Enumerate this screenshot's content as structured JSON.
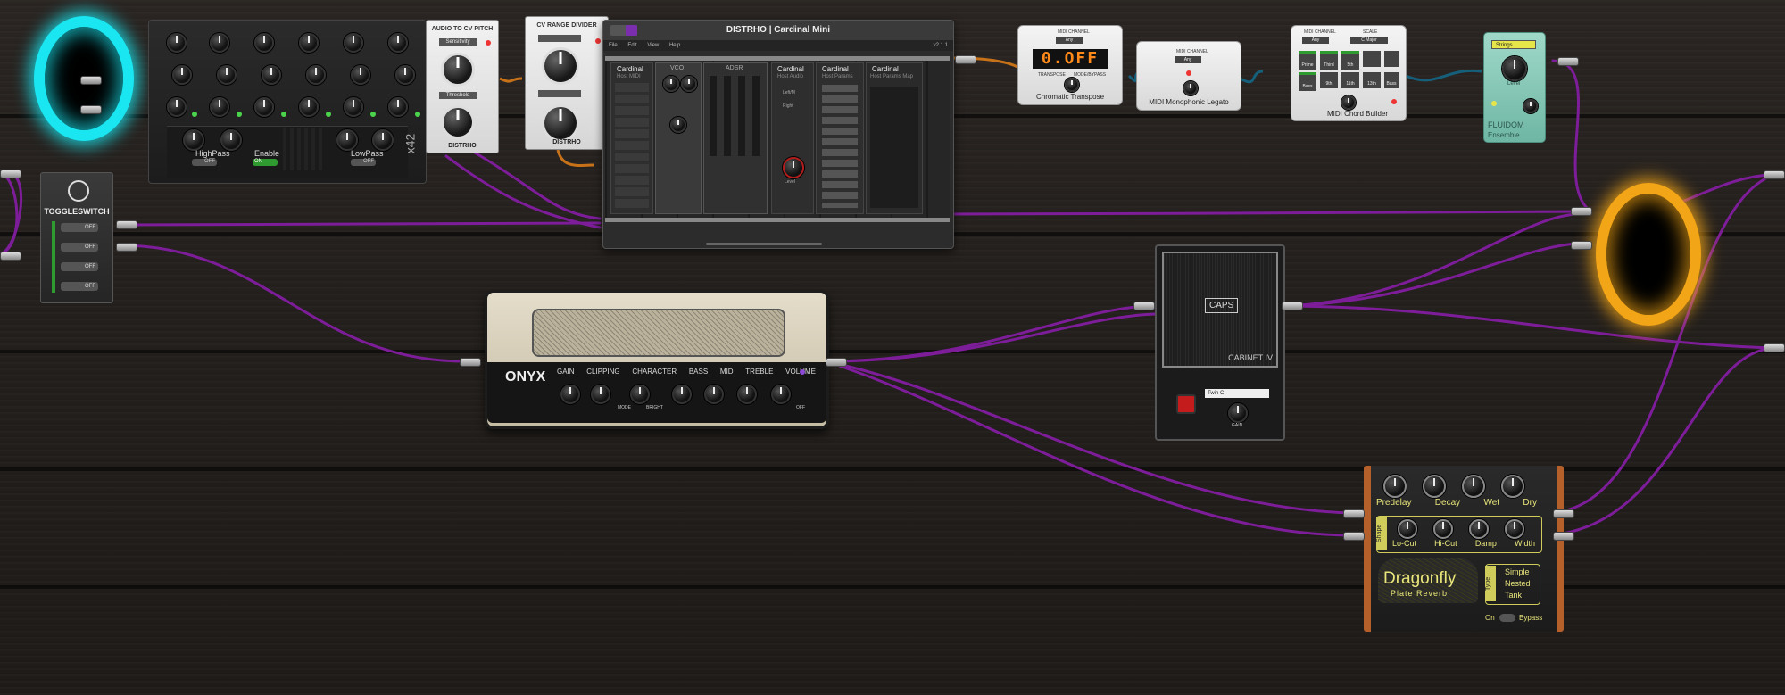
{
  "colors": {
    "cable": "#8a1fa6",
    "portal_left": "#19e6f0",
    "portal_right": "#f2a516",
    "wood": "#231f1c"
  },
  "mixer": {
    "highpass_label": "HighPass",
    "enable_label": "Enable",
    "lowpass_label": "LowPass",
    "x_label": "x42",
    "off": "OFF",
    "on": "ON"
  },
  "toggleswitch": {
    "title": "TOGGLESWITCH",
    "states": [
      "OFF",
      "OFF",
      "OFF",
      "OFF"
    ]
  },
  "audio_cv": {
    "title": "AUDIO TO CV PITCH",
    "sensitivity": "Sensitivity",
    "threshold": "Threshold",
    "brand": "DISTRHO"
  },
  "cv_range": {
    "title": "CV RANGE DIVIDER",
    "brand": "DISTRHO"
  },
  "cardinal": {
    "window_title": "DISTRHO | Cardinal Mini",
    "menu": [
      "File",
      "Edit",
      "View",
      "Help"
    ],
    "version": "v2.1.1",
    "brand": "Cardinal",
    "modules": [
      "Host MIDI",
      "VCO",
      "ADSR",
      "Host Audio",
      "Host Params",
      "Host Params Map"
    ],
    "midi_rows": [
      "V/Oct",
      "Gate",
      "Velocity",
      "Aftertouch",
      "Pitchbend",
      "Mod Wheel",
      "Retrigger",
      "Clock",
      "Start",
      "Stop",
      "Continue"
    ],
    "audio_labels": [
      "Left/M",
      "Right",
      "Level"
    ]
  },
  "chromatic": {
    "title": "Chromatic Transpose",
    "midi_label": "MIDI CHANNEL",
    "midi_value": "Any",
    "display": "0.OFF",
    "transpose": "TRANSPOSE",
    "mode": "MODE/BYPASS"
  },
  "legato": {
    "title": "MIDI Monophonic Legato",
    "midi_label": "MIDI CHANNEL",
    "midi_value": "Any"
  },
  "chord": {
    "title": "MIDI Chord Builder",
    "midi_label": "MIDI CHANNEL",
    "midi_value": "Any",
    "scale_label": "SCALE",
    "scale_value": "C Major",
    "buttons": [
      "Prime",
      "Third",
      "5th",
      "",
      "Bass",
      "9th",
      "11th",
      "13th",
      "Bass"
    ]
  },
  "fluidom": {
    "title": "FLUIDOM",
    "subtitle": "Ensemble",
    "select": "Strings",
    "level": "Level"
  },
  "amp": {
    "brand": "ONYX",
    "controls": [
      "GAIN",
      "CLIPPING",
      "CHARACTER",
      "BASS",
      "MID",
      "TREBLE",
      "VOLUME"
    ],
    "sub_labels": [
      "MODE",
      "BRIGHT",
      "OFF"
    ]
  },
  "cabinet": {
    "brand": "CAPS",
    "model": "CABINET IV",
    "preset": "Twin C",
    "gain": "GAIN"
  },
  "dragonfly": {
    "knobs_top": [
      "Predelay",
      "Decay",
      "Wet",
      "Dry"
    ],
    "knobs_mid": [
      "Lo-Cut",
      "Hi-Cut",
      "Damp",
      "Width"
    ],
    "shape_label": "Shape",
    "type_label": "Type",
    "types": [
      "Simple",
      "Nested",
      "Tank"
    ],
    "name": "Dragonfly",
    "sub": "Plate Reverb",
    "on": "On",
    "bypass": "Bypass"
  }
}
